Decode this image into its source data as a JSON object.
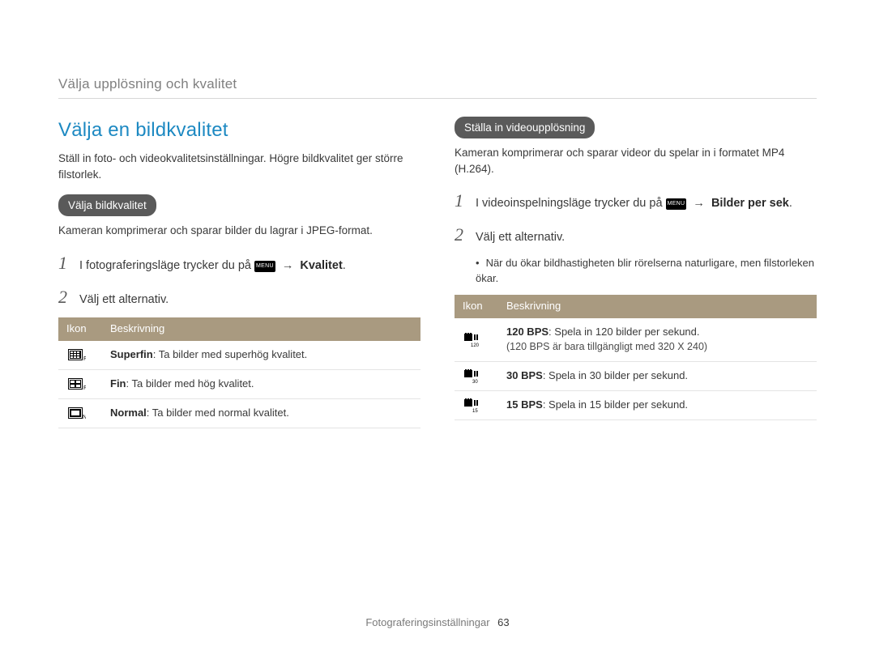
{
  "breadcrumb": "Välja upplösning och kvalitet",
  "section_title": "Välja en bildkvalitet",
  "intro": "Ställ in foto- och videokvalitetsinställningar. Högre bildkvalitet ger större filstorlek.",
  "menu_badge": "MENU",
  "arrow": "→",
  "left": {
    "pill": "Välja bildkvalitet",
    "para": "Kameran komprimerar och sparar bilder du lagrar i JPEG-format.",
    "steps": [
      {
        "pre": "I fotograferingsläge trycker du på ",
        "post_bold": "Kvalitet",
        "tail": "."
      },
      {
        "text": "Välj ett alternativ."
      }
    ],
    "table": {
      "headers": [
        "Ikon",
        "Beskrivning"
      ],
      "rows": [
        {
          "icon": "quality-superfine-icon",
          "title": "Superfin",
          "desc": ": Ta bilder med superhög kvalitet."
        },
        {
          "icon": "quality-fine-icon",
          "title": "Fin",
          "desc": ": Ta bilder med hög kvalitet."
        },
        {
          "icon": "quality-normal-icon",
          "title": "Normal",
          "desc": ": Ta bilder med normal kvalitet."
        }
      ]
    }
  },
  "right": {
    "pill": "Ställa in videoupplösning",
    "para": "Kameran komprimerar och sparar videor du spelar in i formatet MP4 (H.264).",
    "steps": [
      {
        "pre": "I videoinspelningsläge trycker du på ",
        "post_bold": "Bilder per sek",
        "tail": "."
      },
      {
        "text": "Välj ett alternativ."
      }
    ],
    "subnote": "När du ökar bildhastigheten blir rörelserna naturligare, men filstorleken ökar.",
    "table": {
      "headers": [
        "Ikon",
        "Beskrivning"
      ],
      "rows": [
        {
          "icon": "fps-120-icon",
          "sub": "120",
          "title": "120 BPS",
          "desc": ": Spela in 120 bilder per sekund.",
          "note": "(120 BPS är bara tillgängligt med 320 X 240)"
        },
        {
          "icon": "fps-30-icon",
          "sub": "30",
          "title": "30 BPS",
          "desc": ": Spela in 30 bilder per sekund."
        },
        {
          "icon": "fps-15-icon",
          "sub": "15",
          "title": "15 BPS",
          "desc": ": Spela in 15 bilder per sekund."
        }
      ]
    }
  },
  "footer": {
    "label": "Fotograferingsinställningar",
    "page": "63"
  }
}
